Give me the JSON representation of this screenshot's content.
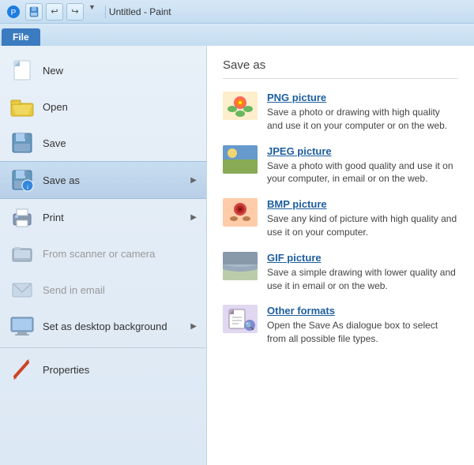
{
  "titlebar": {
    "title": "Untitled - Paint",
    "buttons": [
      {
        "label": "💾",
        "name": "save-btn"
      },
      {
        "label": "↩",
        "name": "undo-btn"
      },
      {
        "label": "↪",
        "name": "redo-btn"
      }
    ],
    "quick_access_arrow": "▼"
  },
  "ribbon": {
    "tabs": [
      {
        "label": "File",
        "active": true
      }
    ]
  },
  "left_menu": {
    "items": [
      {
        "label": "New",
        "icon": "new",
        "disabled": false,
        "has_arrow": false
      },
      {
        "label": "Open",
        "icon": "open",
        "disabled": false,
        "has_arrow": false
      },
      {
        "label": "Save",
        "icon": "save",
        "disabled": false,
        "has_arrow": false
      },
      {
        "label": "Save as",
        "icon": "saveas",
        "disabled": false,
        "has_arrow": true,
        "active": true
      },
      {
        "label": "Print",
        "icon": "print",
        "disabled": false,
        "has_arrow": true
      },
      {
        "label": "From scanner or camera",
        "icon": "scanner",
        "disabled": true,
        "has_arrow": false
      },
      {
        "label": "Send in email",
        "icon": "email",
        "disabled": true,
        "has_arrow": false
      },
      {
        "label": "Set as desktop background",
        "icon": "desktop",
        "disabled": false,
        "has_arrow": true
      },
      {
        "label": "Properties",
        "icon": "properties",
        "disabled": false,
        "has_arrow": false
      }
    ]
  },
  "right_panel": {
    "title": "Save as",
    "options": [
      {
        "title": "PNG picture",
        "desc": "Save a photo or drawing with high quality and use it on your computer or on the web.",
        "icon": "png"
      },
      {
        "title": "JPEG picture",
        "desc": "Save a photo with good quality and use it on your computer, in email or on the web.",
        "icon": "jpeg"
      },
      {
        "title": "BMP picture",
        "desc": "Save any kind of picture with high quality and use it on your computer.",
        "icon": "bmp"
      },
      {
        "title": "GIF picture",
        "desc": "Save a simple drawing with lower quality and use it in email or on the web.",
        "icon": "gif"
      },
      {
        "title": "Other formats",
        "desc": "Open the Save As dialogue box to select from all possible file types.",
        "icon": "other"
      }
    ]
  }
}
